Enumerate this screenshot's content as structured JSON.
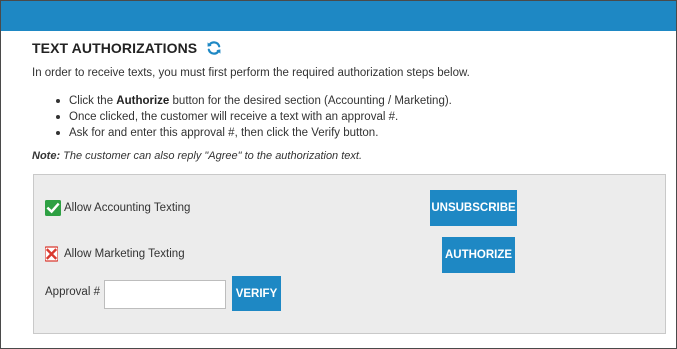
{
  "header": {
    "title": "TEXT AUTHORIZATIONS",
    "refresh_icon": "refresh-icon",
    "bar_color": "#1e88c4"
  },
  "intro": "In order to receive texts, you must first perform the required authorization steps below.",
  "steps": [
    {
      "prefix": "Click the ",
      "bold": "Authorize",
      "suffix": " button for the desired section (Accounting / Marketing)."
    },
    {
      "text": "Once clicked, the customer will receive a text with an approval #."
    },
    {
      "text": "Ask for and enter this approval #, then click the Verify button."
    }
  ],
  "note": {
    "label": "Note:",
    "text": " The customer can also reply \"Agree\" to the authorization text."
  },
  "sections": {
    "accounting": {
      "label": "Allow Accounting Texting",
      "status": "authorized",
      "status_icon": "check-icon",
      "button_label": "UNSUBSCRIBE"
    },
    "marketing": {
      "label": "Allow Marketing Texting",
      "status": "not-authorized",
      "status_icon": "x-icon",
      "button_label": "AUTHORIZE"
    }
  },
  "approval": {
    "label": "Approval #",
    "value": "",
    "placeholder": "",
    "button_label": "VERIFY"
  },
  "colors": {
    "accent": "#1e88c4",
    "check_green": "#2ea043",
    "x_red": "#d9392f"
  }
}
